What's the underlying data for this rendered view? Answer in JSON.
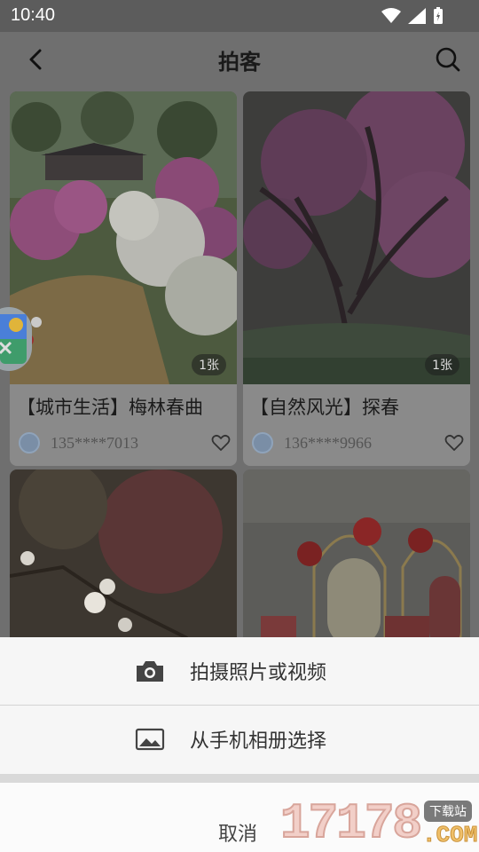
{
  "status_bar": {
    "time": "10:40"
  },
  "header": {
    "title": "拍客"
  },
  "cards": [
    {
      "count": "1张",
      "caption": "【城市生活】梅林春曲",
      "user": "135****7013"
    },
    {
      "count": "1张",
      "caption": "【自然风光】探春",
      "user": "136****9966"
    }
  ],
  "sheet": {
    "option_camera": "拍摄照片或视频",
    "option_album": "从手机相册选择",
    "cancel": "取消"
  },
  "watermark": {
    "number": "17178",
    "tag": "下载站",
    "domain": ".COM"
  }
}
